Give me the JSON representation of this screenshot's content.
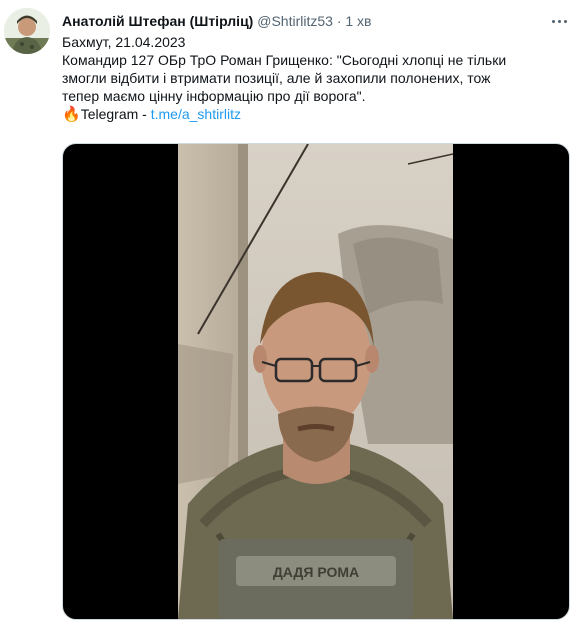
{
  "tweet": {
    "author_name": "Анатолій Штефан (Штірліц)",
    "handle": "@Shtirlitz53",
    "dot": "·",
    "time": "1 хв",
    "lines": [
      "Бахмут, 21.04.2023",
      "Командир 127 ОБр ТрО Роман Грищенко: \"Сьогодні хлопці не тільки",
      "змогли відбити і втримати позиції, але й захопили полонених, тож",
      "тепер маємо цінну інформацію про дії ворога\"."
    ],
    "source_prefix": "Telegram - ",
    "source_link": "t.me/a_shtirlitz",
    "fire_icon": "🔥",
    "media": {
      "vest_patch_text": "ДАДЯ РОМА"
    }
  }
}
